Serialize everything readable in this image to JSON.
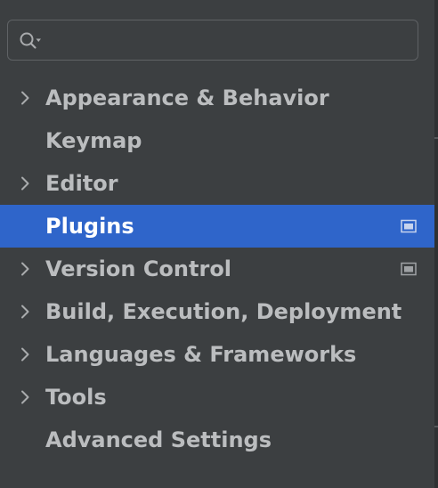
{
  "search": {
    "placeholder": "",
    "value": ""
  },
  "icons": {
    "search": "search-icon",
    "chevron": "chevron-right-icon",
    "badge": "project-level-settings-icon"
  },
  "colors": {
    "background": "#3c3f41",
    "selection": "#2f65ca",
    "text": "#bbbdbf",
    "selected_text": "#ffffff"
  },
  "tree": {
    "items": [
      {
        "label": "Appearance & Behavior",
        "expandable": true,
        "selected": false,
        "badge": false
      },
      {
        "label": "Keymap",
        "expandable": false,
        "selected": false,
        "badge": false
      },
      {
        "label": "Editor",
        "expandable": true,
        "selected": false,
        "badge": false
      },
      {
        "label": "Plugins",
        "expandable": false,
        "selected": true,
        "badge": true
      },
      {
        "label": "Version Control",
        "expandable": true,
        "selected": false,
        "badge": true
      },
      {
        "label": "Build, Execution, Deployment",
        "expandable": true,
        "selected": false,
        "badge": false
      },
      {
        "label": "Languages & Frameworks",
        "expandable": true,
        "selected": false,
        "badge": false
      },
      {
        "label": "Tools",
        "expandable": true,
        "selected": false,
        "badge": false
      },
      {
        "label": "Advanced Settings",
        "expandable": false,
        "selected": false,
        "badge": false
      }
    ]
  }
}
